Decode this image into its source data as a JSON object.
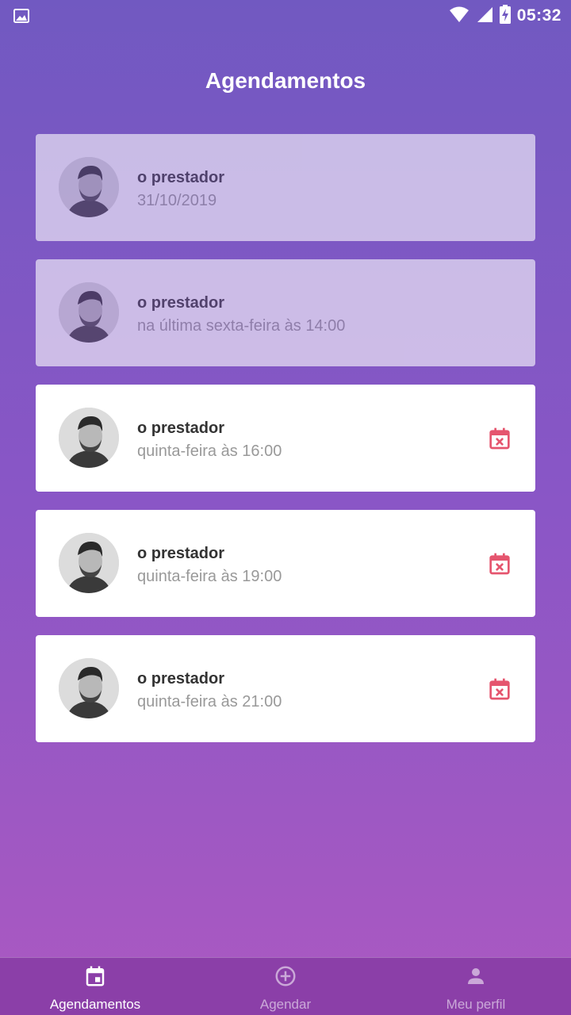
{
  "status_bar": {
    "time": "05:32"
  },
  "header": {
    "title": "Agendamentos"
  },
  "appointments": [
    {
      "provider": "o prestador",
      "date": "31/10/2019",
      "past": true
    },
    {
      "provider": "o prestador",
      "date": "na última sexta-feira às 14:00",
      "past": true
    },
    {
      "provider": "o prestador",
      "date": "quinta-feira às 16:00",
      "past": false
    },
    {
      "provider": "o prestador",
      "date": "quinta-feira às 19:00",
      "past": false
    },
    {
      "provider": "o prestador",
      "date": "quinta-feira às 21:00",
      "past": false
    }
  ],
  "tabbar": {
    "tabs": [
      {
        "label": "Agendamentos",
        "icon": "calendar-icon",
        "active": true
      },
      {
        "label": "Agendar",
        "icon": "add-circle-icon",
        "active": false
      },
      {
        "label": "Meu perfil",
        "icon": "person-icon",
        "active": false
      }
    ]
  },
  "colors": {
    "cancel": "#e5556e",
    "accent": "#7159c1"
  }
}
